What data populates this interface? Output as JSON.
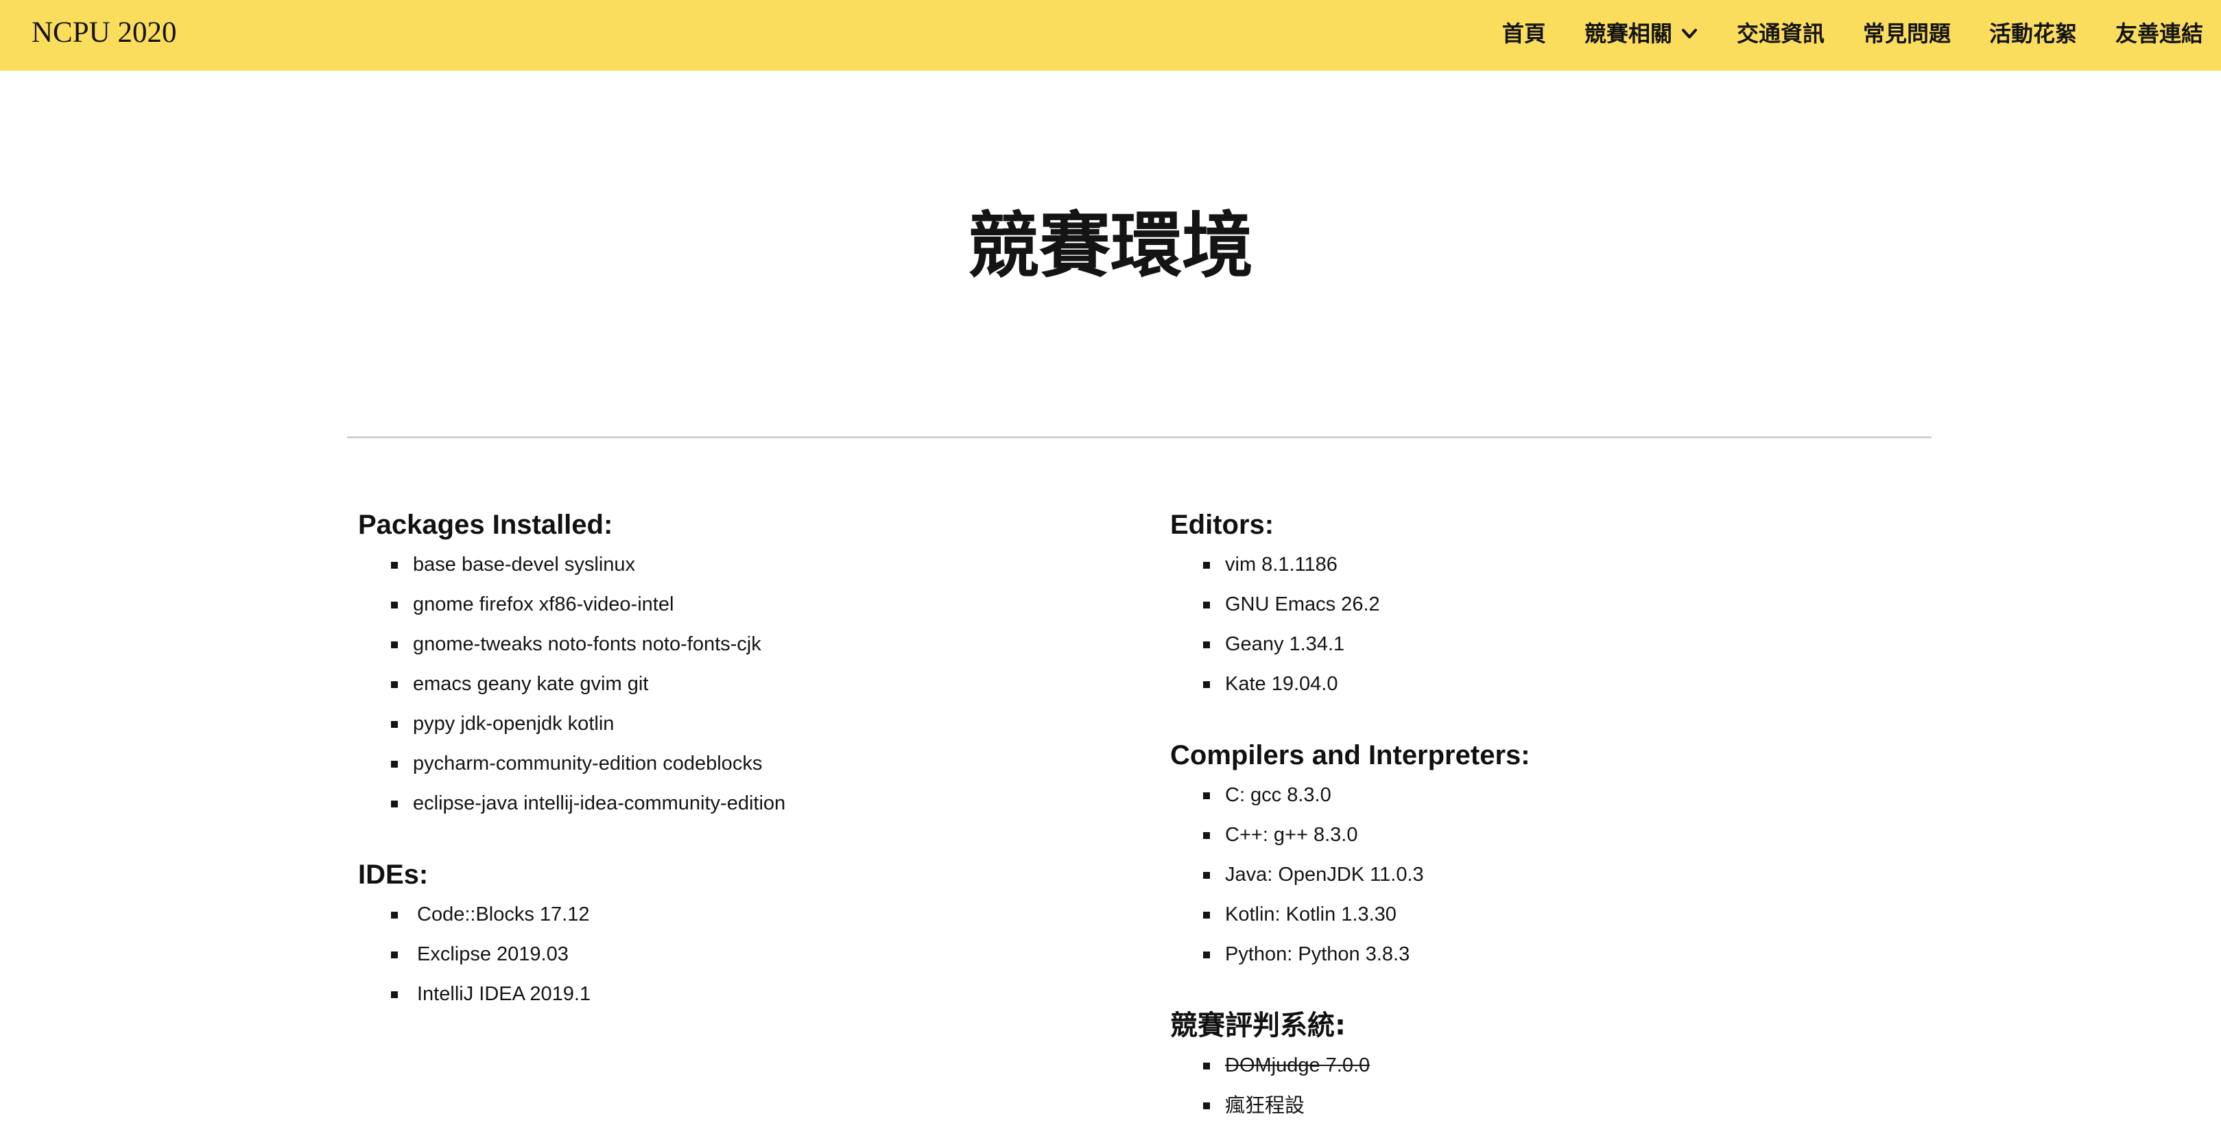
{
  "navbar": {
    "brand": "NCPU 2020",
    "items": [
      {
        "label": "首頁"
      },
      {
        "label": "競賽相關",
        "has_dropdown": true,
        "icon": "chevron-down-icon"
      },
      {
        "label": "交通資訊"
      },
      {
        "label": "常見問題"
      },
      {
        "label": "活動花絮"
      },
      {
        "label": "友善連結"
      }
    ],
    "background_color": "#fbdd5e"
  },
  "page": {
    "title": "競賽環境"
  },
  "left_column": {
    "packages": {
      "heading": "Packages Installed:",
      "items": [
        "base base-devel syslinux",
        "gnome firefox xf86-video-intel",
        "gnome-tweaks noto-fonts noto-fonts-cjk",
        "emacs geany kate gvim git",
        "pypy jdk-openjdk kotlin",
        "pycharm-community-edition codeblocks",
        "eclipse-java intellij-idea-community-edition"
      ]
    },
    "ides": {
      "heading": "IDEs:",
      "items": [
        "Code::Blocks 17.12",
        "Exclipse 2019.03",
        "IntelliJ IDEA 2019.1"
      ]
    }
  },
  "right_column": {
    "editors": {
      "heading": "Editors:",
      "items": [
        "vim 8.1.1186",
        "GNU Emacs 26.2",
        "Geany 1.34.1",
        "Kate 19.04.0"
      ]
    },
    "compilers": {
      "heading": "Compilers and Interpreters:",
      "items": [
        "C: gcc 8.3.0",
        "C++: g++ 8.3.0",
        "Java: OpenJDK 11.0.3",
        "Kotlin: Kotlin 1.3.30",
        "Python: Python 3.8.3"
      ]
    },
    "judge": {
      "heading": "競賽評判系統:",
      "items": [
        {
          "label": "DOMjudge 7.0.0",
          "struck_through": true
        },
        {
          "label": "瘋狂程設",
          "struck_through": false
        }
      ]
    }
  }
}
